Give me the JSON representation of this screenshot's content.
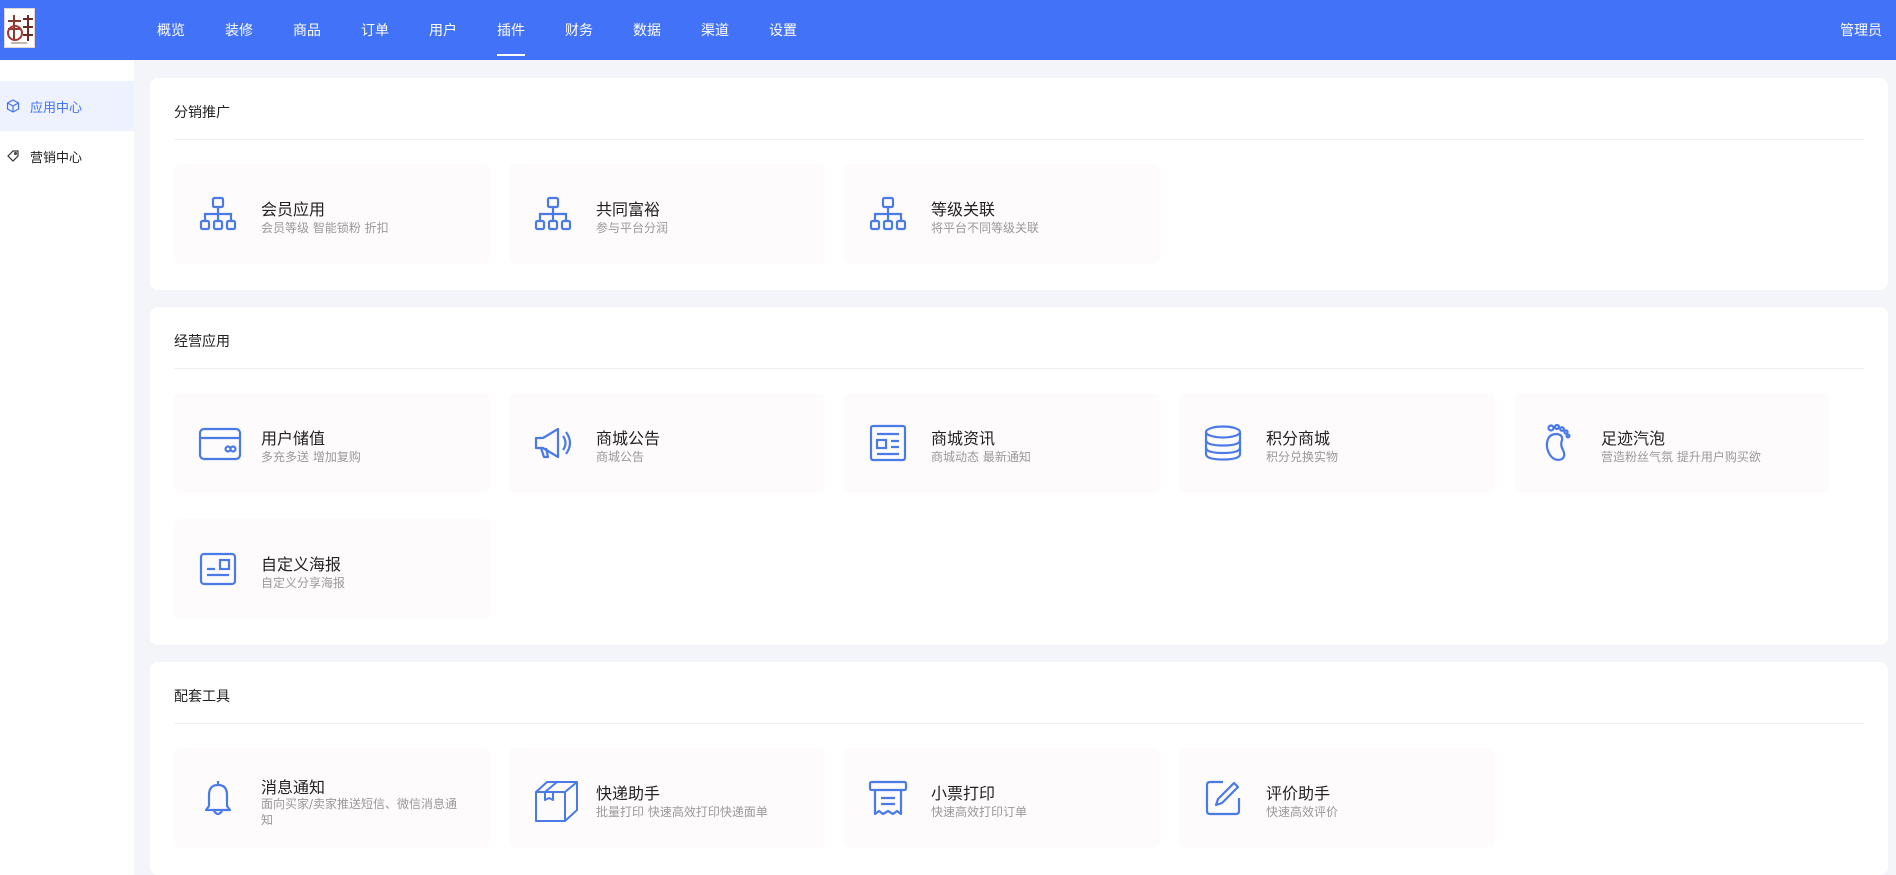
{
  "header": {
    "nav": [
      "概览",
      "装修",
      "商品",
      "订单",
      "用户",
      "插件",
      "财务",
      "数据",
      "渠道",
      "设置"
    ],
    "active_index": 5,
    "admin_label": "管理员"
  },
  "sidebar": {
    "items": [
      {
        "label": "应用中心",
        "icon": "cube-icon",
        "active": true
      },
      {
        "label": "营销中心",
        "icon": "tag-icon",
        "active": false
      }
    ]
  },
  "sections": [
    {
      "title": "分销推广",
      "cards": [
        {
          "title": "会员应用",
          "desc": "会员等级 智能锁粉 折扣",
          "icon": "org-chart-icon"
        },
        {
          "title": "共同富裕",
          "desc": "参与平台分润",
          "icon": "org-chart-icon"
        },
        {
          "title": "等级关联",
          "desc": "将平台不同等级关联",
          "icon": "org-chart-icon"
        }
      ]
    },
    {
      "title": "经营应用",
      "cards": [
        {
          "title": "用户储值",
          "desc": "多充多送 增加复购",
          "icon": "card-icon"
        },
        {
          "title": "商城公告",
          "desc": "商城公告",
          "icon": "megaphone-icon"
        },
        {
          "title": "商城资讯",
          "desc": "商城动态 最新通知",
          "icon": "news-icon"
        },
        {
          "title": "积分商城",
          "desc": "积分兑换实物",
          "icon": "coins-icon"
        },
        {
          "title": "足迹汽泡",
          "desc": "营造粉丝气氛 提升用户购买欲",
          "icon": "footprint-icon"
        },
        {
          "title": "自定义海报",
          "desc": "自定义分享海报",
          "icon": "poster-icon"
        }
      ]
    },
    {
      "title": "配套工具",
      "cards": [
        {
          "title": "消息通知",
          "desc": "面向买家/卖家推送短信、微信消息通知",
          "icon": "bell-icon"
        },
        {
          "title": "快递助手",
          "desc": "批量打印 快速高效打印快递面单",
          "icon": "box-icon"
        },
        {
          "title": "小票打印",
          "desc": "快速高效打印订单",
          "icon": "printer-icon"
        },
        {
          "title": "评价助手",
          "desc": "快速高效评价",
          "icon": "edit-icon"
        }
      ]
    }
  ],
  "colors": {
    "primary": "#4272f7",
    "icon_blue": "#4a7ae8",
    "background": "#f4f5f9",
    "card_bg": "#fefbfd"
  }
}
